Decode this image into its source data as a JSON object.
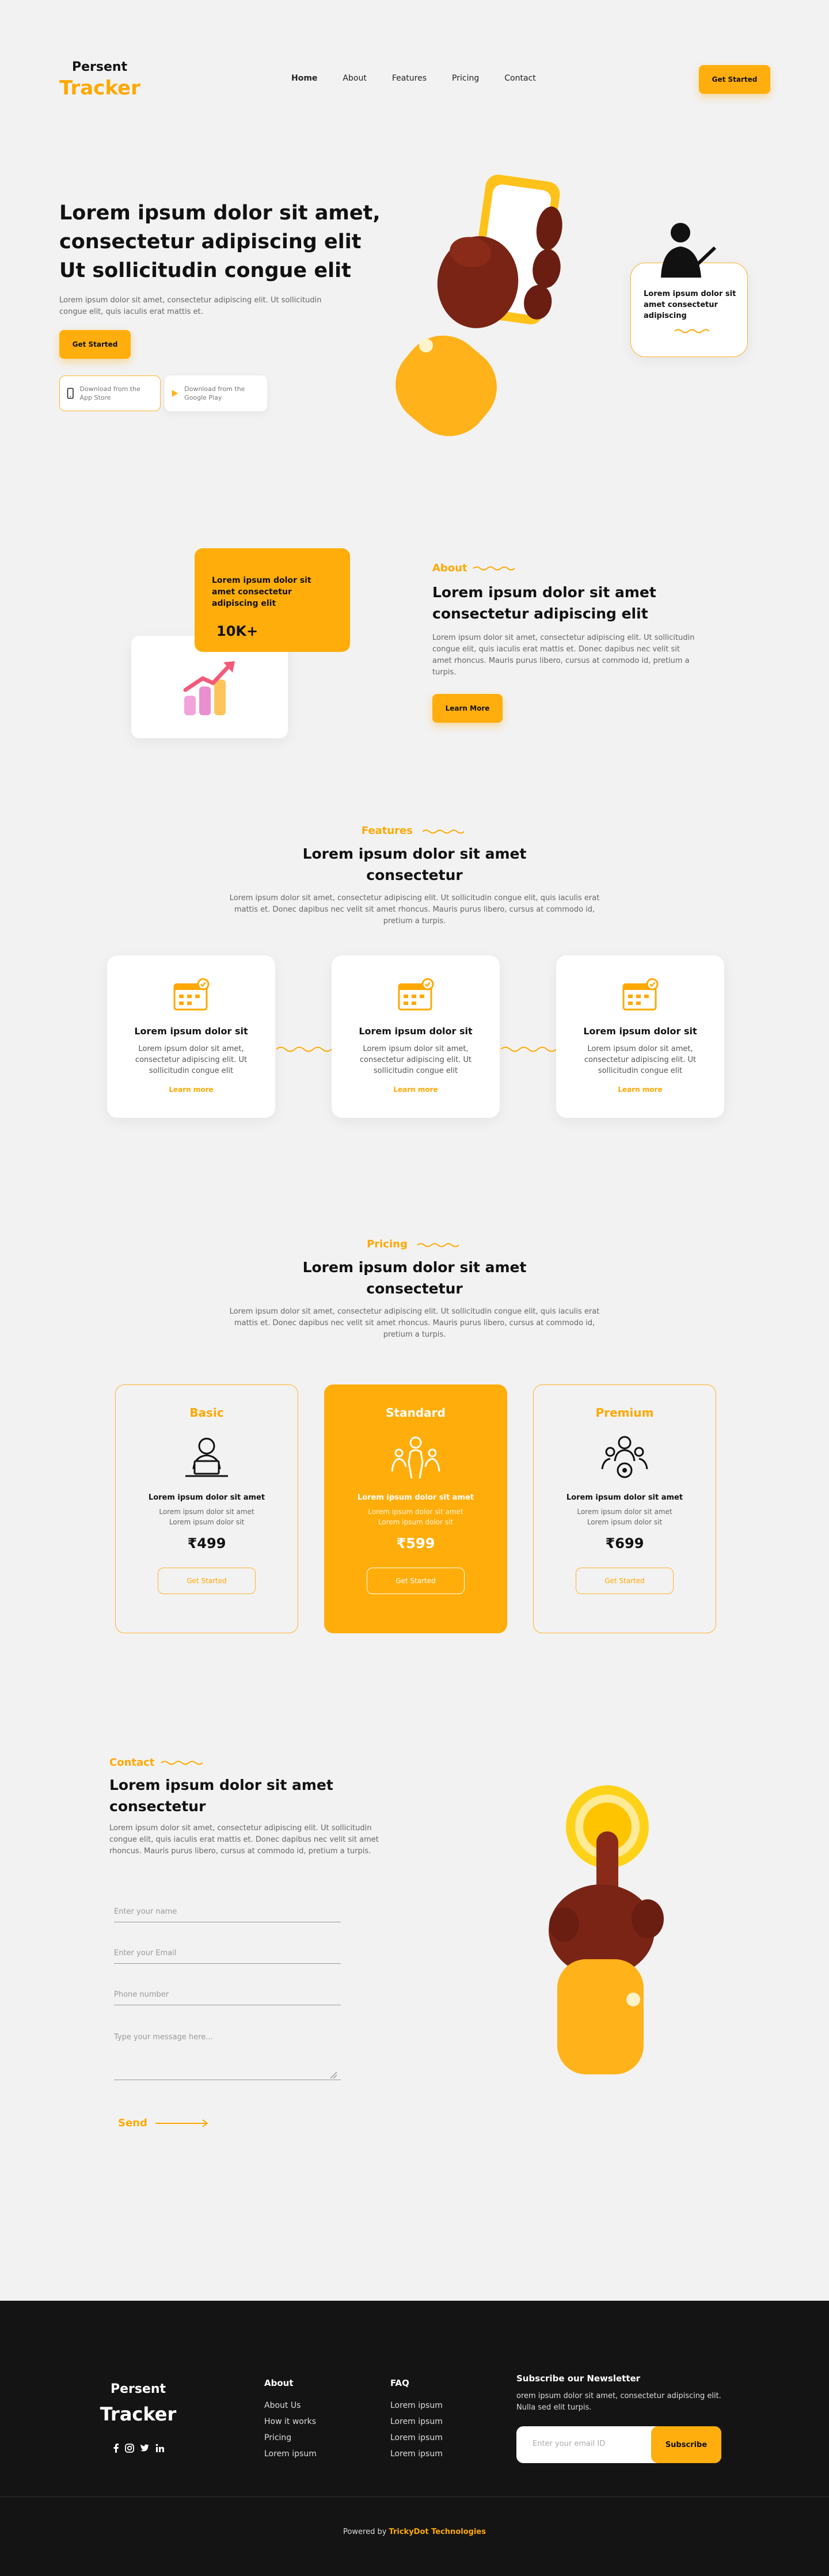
{
  "brand": {
    "line1": "Persent",
    "line2": "Tracker"
  },
  "nav": {
    "items": [
      "Home",
      "About",
      "Features",
      "Pricing",
      "Contact"
    ],
    "cta": "Get Started"
  },
  "hero": {
    "title": "Lorem ipsum dolor sit amet, consectetur adipiscing elit Ut sollicitudin congue elit",
    "text": "Lorem ipsum dolor sit amet, consectetur adipiscing elit. Ut sollicitudin congue elit, quis iaculis erat mattis et.",
    "cta": "Get Started",
    "appstore": "Download from the App Store",
    "playstore": "Download from the Google Play",
    "badge": "Lorem ipsum dolor sit amet consectetur adipiscing"
  },
  "about": {
    "label": "About",
    "title": "Lorem ipsum dolor sit amet consectetur adipiscing elit",
    "text": "Lorem ipsum dolor sit amet, consectetur adipiscing elit. Ut sollicitudin congue elit, quis iaculis erat mattis et. Donec dapibus nec velit sit amet rhoncus. Mauris purus libero, cursus at commodo id, pretium a turpis.",
    "cta": "Learn More",
    "stat_title": "Lorem ipsum dolor sit amet consectetur adipiscing elit",
    "stat_value": "10K+"
  },
  "features": {
    "label": "Features",
    "title": "Lorem ipsum dolor sit amet consectetur",
    "text": "Lorem ipsum dolor sit amet, consectetur adipiscing elit. Ut sollicitudin congue elit, quis iaculis erat mattis et. Donec dapibus nec velit sit amet rhoncus. Mauris purus libero, cursus at commodo id, pretium a turpis.",
    "cards": [
      {
        "title": "Lorem ipsum dolor sit",
        "text": "Lorem ipsum dolor sit amet, consectetur adipiscing elit. Ut sollicitudin congue elit",
        "link": "Learn more"
      },
      {
        "title": "Lorem ipsum dolor sit",
        "text": "Lorem ipsum dolor sit amet, consectetur adipiscing elit. Ut sollicitudin congue elit",
        "link": "Learn more"
      },
      {
        "title": "Lorem ipsum dolor sit",
        "text": "Lorem ipsum dolor sit amet, consectetur adipiscing elit. Ut sollicitudin congue elit",
        "link": "Learn more"
      }
    ]
  },
  "pricing": {
    "label": "Pricing",
    "title": "Lorem ipsum dolor sit amet consectetur",
    "text": "Lorem ipsum dolor sit amet, consectetur adipiscing elit. Ut sollicitudin congue elit, quis iaculis erat mattis et. Donec dapibus nec velit sit amet rhoncus. Mauris purus libero, cursus at commodo id, pretium a turpis.",
    "plans": [
      {
        "name": "Basic",
        "title": "Lorem ipsum dolor sit amet",
        "line1": "Lorem ipsum dolor sit amet",
        "line2": "Lorem ipsum dolor sit",
        "price": "₹499",
        "cta": "Get Started"
      },
      {
        "name": "Standard",
        "title": "Lorem ipsum dolor sit amet",
        "line1": "Lorem ipsum dolor sit amet",
        "line2": "Lorem ipsum dolor sit",
        "price": "₹599",
        "cta": "Get Started"
      },
      {
        "name": "Premium",
        "title": "Lorem ipsum dolor sit amet",
        "line1": "Lorem ipsum dolor sit amet",
        "line2": "Lorem ipsum dolor sit",
        "price": "₹699",
        "cta": "Get Started"
      }
    ]
  },
  "contact": {
    "label": "Contact",
    "title": "Lorem ipsum dolor sit amet consectetur",
    "text": "Lorem ipsum dolor sit amet, consectetur adipiscing elit. Ut sollicitudin congue elit, quis iaculis erat mattis et. Donec dapibus nec velit sit amet rhoncus. Mauris purus libero, cursus at commodo id, pretium a turpis.",
    "name_placeholder": "Enter your name",
    "email_placeholder": "Enter your Email",
    "phone_placeholder": "Phone number",
    "message_placeholder": "Type your message here...",
    "send": "Send"
  },
  "footer": {
    "about_heading": "About",
    "about_links": [
      "About Us",
      "How it works",
      "Pricing",
      "Lorem ipsum"
    ],
    "faq_heading": "FAQ",
    "faq_links": [
      "Lorem ipsum",
      "Lorem ipsum",
      "Lorem ipsum",
      "Lorem ipsum"
    ],
    "newsletter_heading": "Subscribe our Newsletter",
    "newsletter_text": "orem ipsum dolor sit amet, consectetur adipiscing elit. Nulla sed elit turpis.",
    "email_placeholder": "Enter your email ID",
    "subscribe": "Subscribe",
    "powered_prefix": "Powered by",
    "powered_by": "TrickyDot Technologies"
  },
  "colors": {
    "accent": "#ffae0d",
    "dark": "#141414",
    "bg": "#f2f2f2"
  }
}
